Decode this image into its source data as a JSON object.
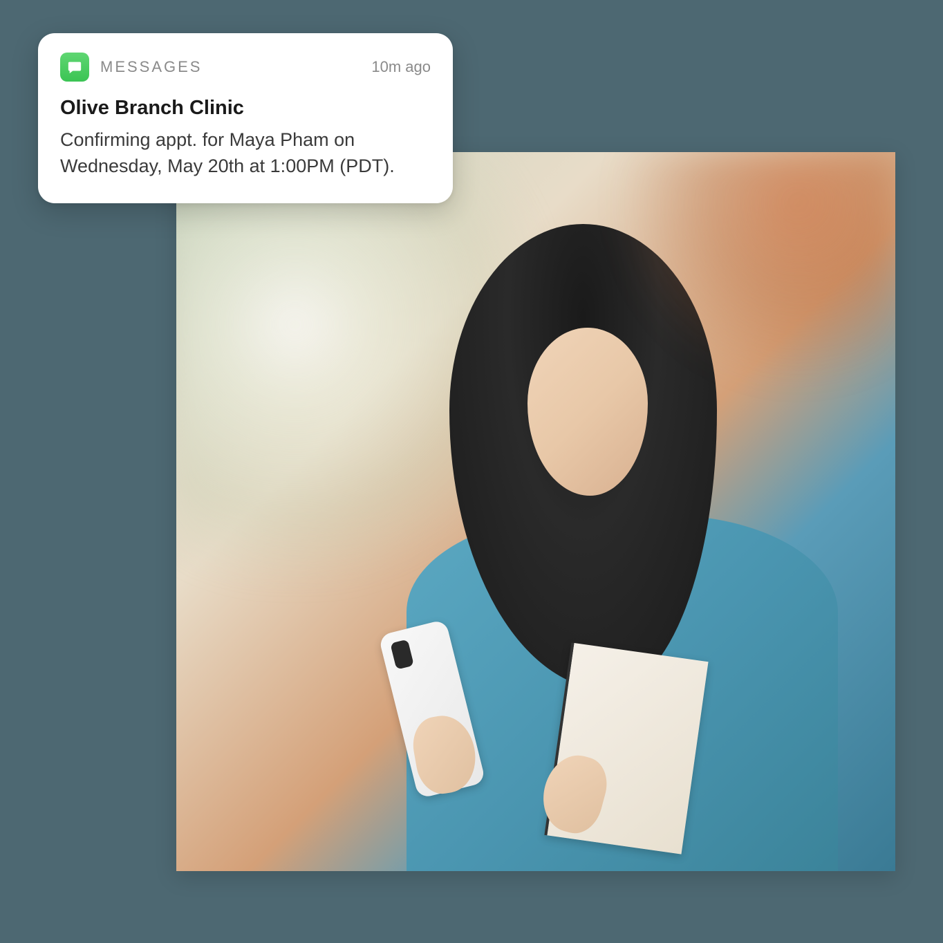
{
  "notification": {
    "app_name": "MESSAGES",
    "timestamp": "10m ago",
    "sender": "Olive Branch Clinic",
    "body": "Confirming appt. for Maya Pham on Wednesday, May 20th at 1:00PM (PDT).",
    "icon": "message-bubble-icon",
    "icon_color": "#4ccc5e"
  },
  "background_photo": {
    "description": "Young woman with long dark hair wearing a teal blue sweater, looking at a white smartphone while holding a notebook, with white earbuds, outdoors with blurred autumn foliage bokeh background"
  }
}
